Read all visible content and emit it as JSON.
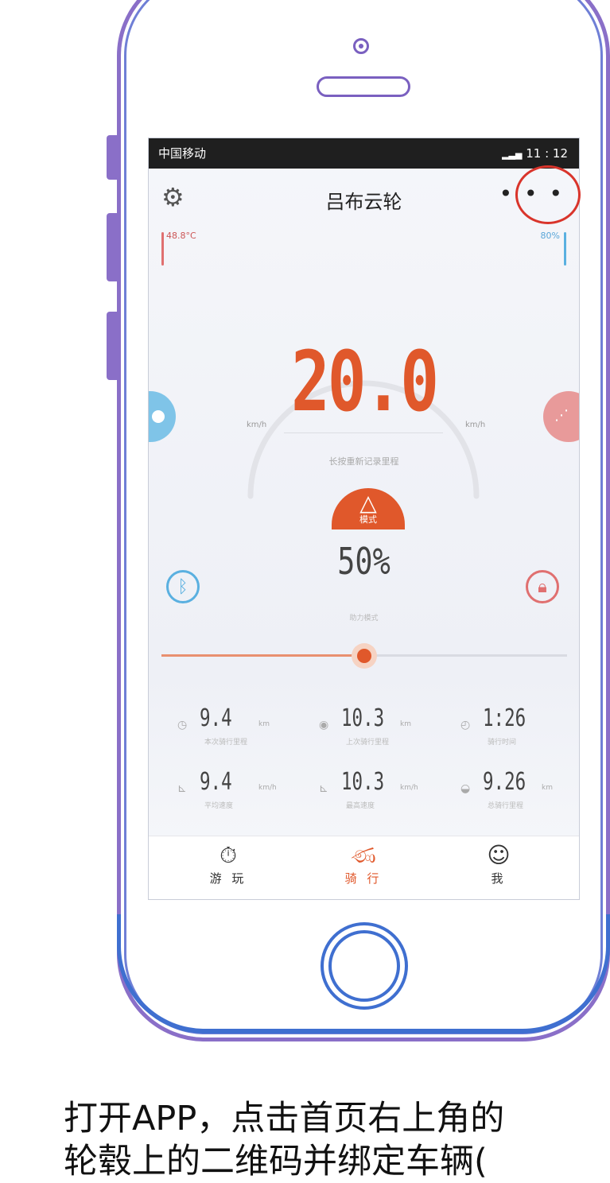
{
  "status_bar": {
    "carrier": "中国移动",
    "time": "11 : 12"
  },
  "nav": {
    "title": "吕布云轮",
    "more_label": "• • •"
  },
  "indicators": {
    "temperature": "48.8°C",
    "battery": "80%"
  },
  "speed": {
    "value": "20.0",
    "sub": "长按重新记录里程",
    "unit_left": "km/h",
    "unit_right": "km/h"
  },
  "mode": {
    "label": "模式",
    "percent": "50%",
    "sub": "助力模式"
  },
  "slider": {
    "level": 0.5
  },
  "stats": [
    {
      "icon": "stopwatch-icon",
      "value": "9.4",
      "unit": "km",
      "label": "本次骑行里程"
    },
    {
      "icon": "gauge-icon",
      "value": "10.3",
      "unit": "km",
      "label": "上次骑行里程"
    },
    {
      "icon": "clock-icon",
      "value": "1:26",
      "unit": "",
      "label": "骑行时间"
    },
    {
      "icon": "avg-speed-icon",
      "value": "9.4",
      "unit": "km/h",
      "label": "平均速度"
    },
    {
      "icon": "max-speed-icon",
      "value": "10.3",
      "unit": "km/h",
      "label": "最高速度"
    },
    {
      "icon": "moon-icon",
      "value": "9.26",
      "unit": "km",
      "label": "总骑行里程"
    }
  ],
  "tabs": [
    {
      "label": "游 玩",
      "icon": "stopwatch-icon"
    },
    {
      "label": "骑 行",
      "icon": "bicycle-icon"
    },
    {
      "label": "我",
      "icon": "person-icon"
    }
  ],
  "caption": {
    "line1": "打开APP，点击首页右上角的",
    "line2": "轮毂上的二维码并绑定车辆("
  },
  "colors": {
    "accent": "#e0582b",
    "phone_frame": "#8a6fc8",
    "phone_frame_bottom": "#3f6fd0",
    "bluetooth": "#5ab0e0",
    "lock": "#e07070",
    "highlight": "#d9342b"
  }
}
